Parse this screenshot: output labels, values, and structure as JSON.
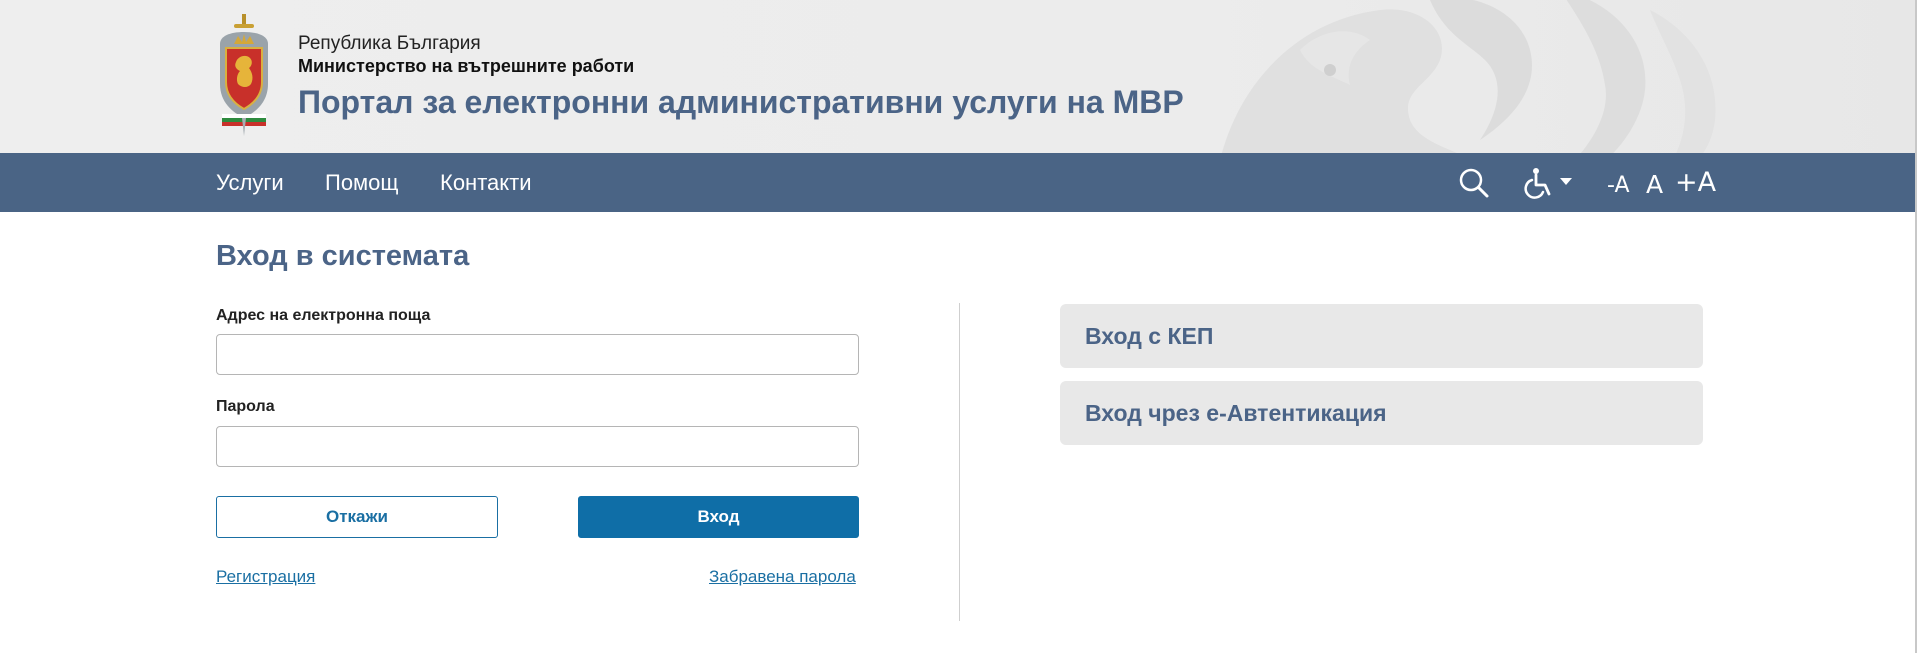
{
  "header": {
    "republic": "Република България",
    "ministry": "Министерство на вътрешните работи",
    "portal_title": "Портал за електронни административни услуги на МВР"
  },
  "nav": {
    "items": [
      "Услуги",
      "Помощ",
      "Контакти"
    ],
    "tools": {
      "search_icon": "search-icon",
      "accessibility_icon": "wheelchair-icon",
      "font_decrease": "-A",
      "font_normal": "A",
      "font_increase": "+A"
    }
  },
  "login": {
    "title": "Вход в системата",
    "email_label": "Адрес на електронна поща",
    "email_value": "",
    "password_label": "Парола",
    "password_value": "",
    "cancel_label": "Откажи",
    "submit_label": "Вход",
    "register_link": "Регистрация",
    "forgot_link": "Забравена парола"
  },
  "alt_login": {
    "kep": "Вход с КЕП",
    "eauth": "Вход чрез е-Автентикация"
  },
  "colors": {
    "navbar": "#4a6485",
    "accent_text": "#4b6487",
    "primary_button": "#0f6ea7",
    "link": "#1a6fa3"
  }
}
